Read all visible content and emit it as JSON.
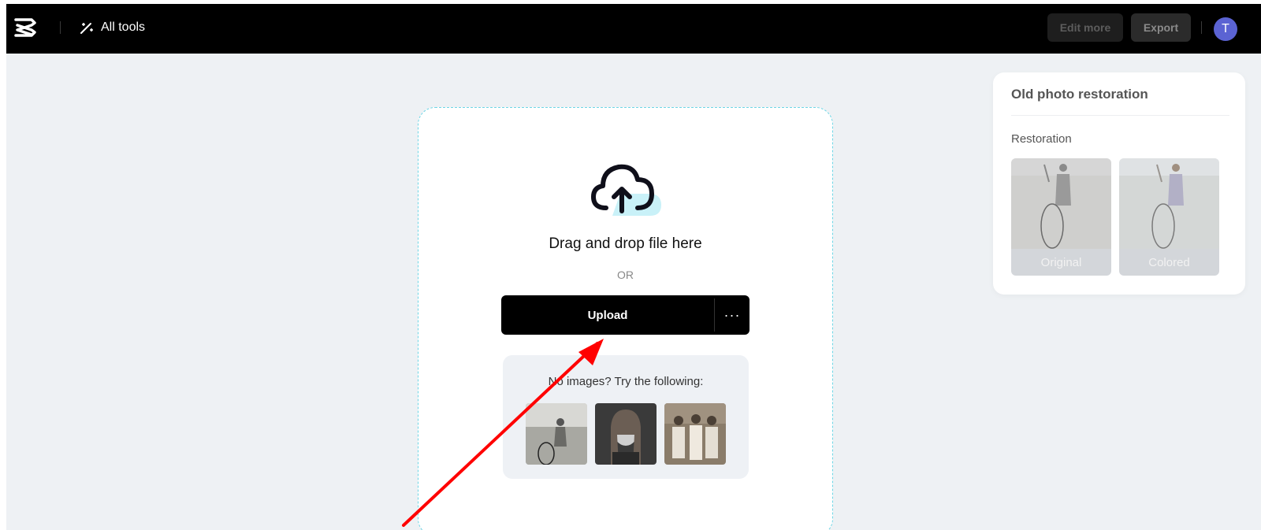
{
  "topbar": {
    "logo_icon": "capcut-logo-icon",
    "all_tools_label": "All tools",
    "all_tools_icon": "magic-wand-icon",
    "edit_more_label": "Edit more",
    "export_label": "Export",
    "avatar_initial": "T",
    "avatar_color": "#5b63d3"
  },
  "upload": {
    "icon": "cloud-upload-icon",
    "title": "Drag and drop file here",
    "or_text": "OR",
    "upload_label": "Upload",
    "more_label": "···",
    "accent_color": "#6fd6e6"
  },
  "samples": {
    "title": "No images? Try the following:",
    "items": [
      "sample-girl-with-hoop",
      "sample-portrait-girl",
      "sample-group-tennis"
    ]
  },
  "panel": {
    "title": "Old photo restoration",
    "section": "Restoration",
    "options": [
      {
        "label": "Original"
      },
      {
        "label": "Colored"
      }
    ]
  },
  "annotation": {
    "arrow_color": "#ff0000"
  }
}
